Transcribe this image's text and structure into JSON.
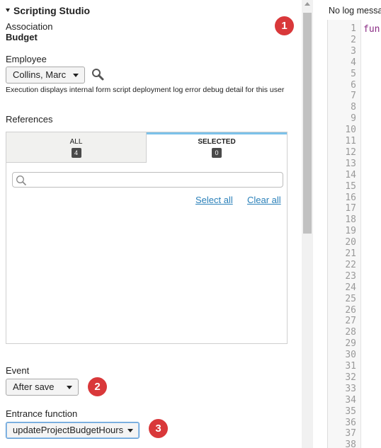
{
  "panel": {
    "title": "Scripting Studio",
    "association_label": "Association",
    "association_value": "Budget",
    "employee_label": "Employee",
    "employee_value": "Collins, Marc",
    "execution_note": "Execution displays internal form script deployment log error debug detail for this user",
    "references_label": "References",
    "tabs": [
      {
        "label": "ALL",
        "count": "4"
      },
      {
        "label": "SELECTED",
        "count": "0"
      }
    ],
    "search_placeholder": "",
    "select_all": "Select all",
    "clear_all": "Clear all",
    "event_label": "Event",
    "event_value": "After save",
    "entrance_label": "Entrance function",
    "entrance_value": "updateProjectBudgetHours"
  },
  "callouts": [
    "1",
    "2",
    "3"
  ],
  "editor": {
    "log_text": "No log messa",
    "code_start": "fun",
    "line_numbers": [
      "1",
      "2",
      "3",
      "4",
      "5",
      "6",
      "7",
      "8",
      "9",
      "10",
      "11",
      "12",
      "13",
      "14",
      "15",
      "16",
      "17",
      "18",
      "19",
      "20",
      "21",
      "22",
      "23",
      "24",
      "25",
      "26",
      "27",
      "28",
      "29",
      "30",
      "31",
      "32",
      "33",
      "34",
      "35",
      "36",
      "37",
      "38"
    ]
  },
  "colors": {
    "accent": "#7cc2ea",
    "callout": "#d9383a",
    "link": "#2a80b9"
  }
}
